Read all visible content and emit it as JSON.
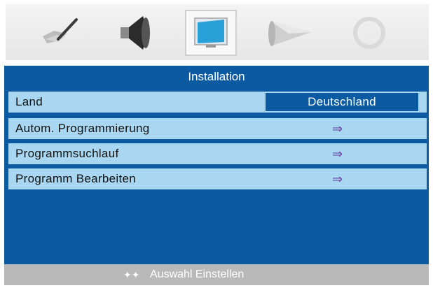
{
  "header": {
    "tabs": [
      {
        "icon": "picture-brush-icon",
        "selected": false
      },
      {
        "icon": "speaker-icon",
        "selected": false
      },
      {
        "icon": "tv-screen-icon",
        "selected": true
      },
      {
        "icon": "cone-feature-icon",
        "selected": false
      },
      {
        "icon": "clock-icon",
        "selected": false
      }
    ]
  },
  "menu": {
    "title": "Installation",
    "rows": [
      {
        "label": "Land",
        "value": "Deutschland"
      },
      {
        "label": "Autom. Programmierung",
        "arrow": "⇒"
      },
      {
        "label": "Programmsuchlauf",
        "arrow": "⇒"
      },
      {
        "label": "Programm Bearbeiten",
        "arrow": "⇒"
      }
    ]
  },
  "footer": {
    "nav_icons": "✦✦",
    "hint": "Auswahl Einstellen"
  },
  "colors": {
    "panel": "#0b5aa2",
    "row": "#a9d7f2",
    "footer": "#b9b9b9"
  }
}
